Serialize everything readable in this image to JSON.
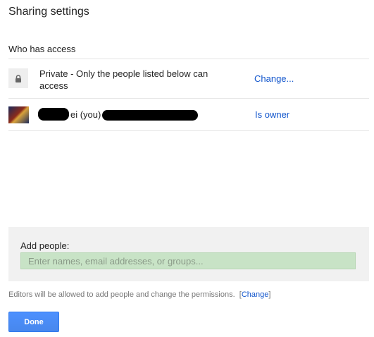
{
  "dialog": {
    "title": "Sharing settings"
  },
  "access": {
    "section_label": "Who has access",
    "visibility": {
      "icon": "lock-icon",
      "text_line1": "Private - Only the people listed below can",
      "text_line2": "access",
      "change_label": "Change..."
    },
    "owner": {
      "avatar": "user-avatar",
      "name_visible": "ei (you)",
      "role_label": "Is owner"
    }
  },
  "add_people": {
    "label": "Add people:",
    "placeholder": "Enter names, email addresses, or groups..."
  },
  "note": {
    "text": "Editors will be allowed to add people and change the permissions.",
    "bracket_open": "[",
    "change_label": "Change",
    "bracket_close": "]"
  },
  "buttons": {
    "done_label": "Done"
  },
  "colors": {
    "link": "#1155cc",
    "primary_button": "#4d90fe",
    "input_bg": "#c8e3c6"
  }
}
